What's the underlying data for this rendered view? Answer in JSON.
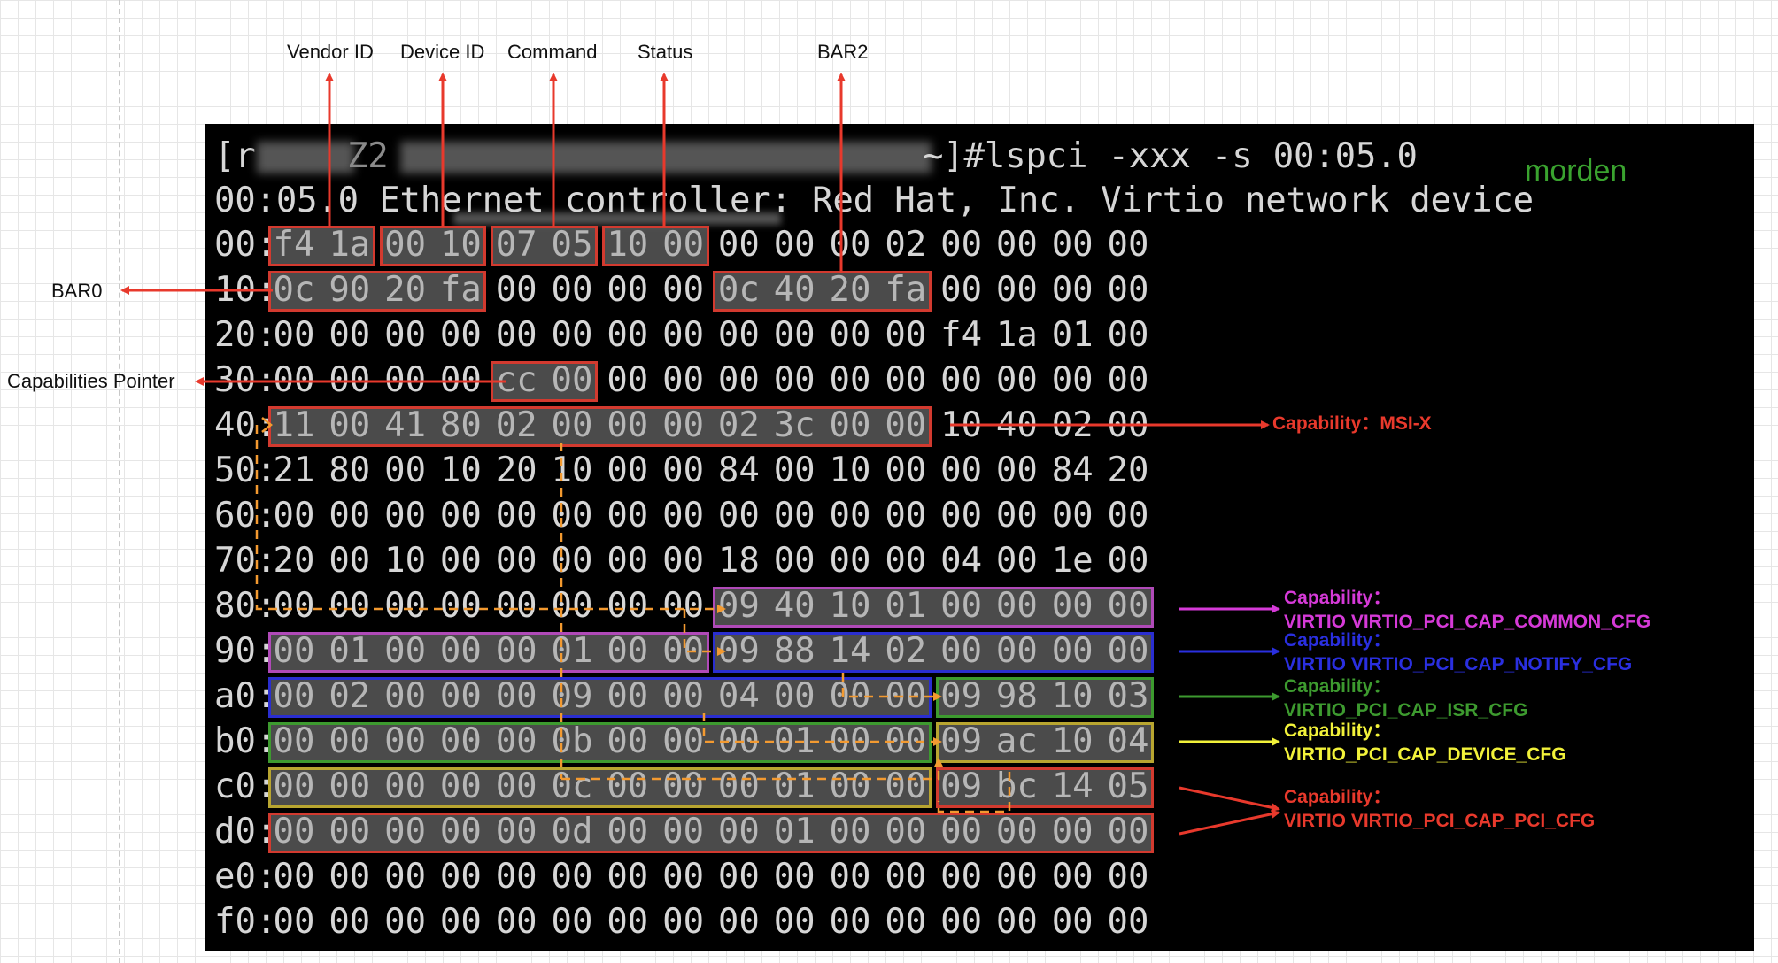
{
  "header_labels": [
    "Vendor ID",
    "Device ID",
    "Command",
    "Status",
    "BAR2"
  ],
  "side_labels": {
    "bar0": "BAR0",
    "capabilities_pointer": "Capabilities Pointer"
  },
  "tag": "morden",
  "terminal": {
    "prompt_prefix": "[r",
    "prompt_host_fragment": "Z2",
    "prompt_command": "~]#lspci -xxx -s 00:05.0",
    "device_line": "00:05.0 Ethernet controller: Red Hat, Inc. Virtio network device"
  },
  "hexdump": [
    {
      "label": "00:",
      "bytes": [
        "f4",
        "1a",
        "00",
        "10",
        "07",
        "05",
        "10",
        "00",
        "00",
        "00",
        "00",
        "02",
        "00",
        "00",
        "00",
        "00"
      ]
    },
    {
      "label": "10:",
      "bytes": [
        "0c",
        "90",
        "20",
        "fa",
        "00",
        "00",
        "00",
        "00",
        "0c",
        "40",
        "20",
        "fa",
        "00",
        "00",
        "00",
        "00"
      ]
    },
    {
      "label": "20:",
      "bytes": [
        "00",
        "00",
        "00",
        "00",
        "00",
        "00",
        "00",
        "00",
        "00",
        "00",
        "00",
        "00",
        "f4",
        "1a",
        "01",
        "00"
      ]
    },
    {
      "label": "30:",
      "bytes": [
        "00",
        "00",
        "00",
        "00",
        "cc",
        "00",
        "00",
        "00",
        "00",
        "00",
        "00",
        "00",
        "00",
        "00",
        "00",
        "00"
      ]
    },
    {
      "label": "40:",
      "bytes": [
        "11",
        "00",
        "41",
        "80",
        "02",
        "00",
        "00",
        "00",
        "02",
        "3c",
        "00",
        "00",
        "10",
        "40",
        "02",
        "00"
      ]
    },
    {
      "label": "50:",
      "bytes": [
        "21",
        "80",
        "00",
        "10",
        "20",
        "10",
        "00",
        "00",
        "84",
        "00",
        "10",
        "00",
        "00",
        "00",
        "84",
        "20"
      ]
    },
    {
      "label": "60:",
      "bytes": [
        "00",
        "00",
        "00",
        "00",
        "00",
        "00",
        "00",
        "00",
        "00",
        "00",
        "00",
        "00",
        "00",
        "00",
        "00",
        "00"
      ]
    },
    {
      "label": "70:",
      "bytes": [
        "20",
        "00",
        "10",
        "00",
        "00",
        "00",
        "00",
        "00",
        "18",
        "00",
        "00",
        "00",
        "04",
        "00",
        "1e",
        "00"
      ]
    },
    {
      "label": "80:",
      "bytes": [
        "00",
        "00",
        "00",
        "00",
        "00",
        "00",
        "00",
        "00",
        "09",
        "40",
        "10",
        "01",
        "00",
        "00",
        "00",
        "00"
      ]
    },
    {
      "label": "90:",
      "bytes": [
        "00",
        "01",
        "00",
        "00",
        "00",
        "01",
        "00",
        "00",
        "09",
        "88",
        "14",
        "02",
        "00",
        "00",
        "00",
        "00"
      ]
    },
    {
      "label": "a0:",
      "bytes": [
        "00",
        "02",
        "00",
        "00",
        "00",
        "09",
        "00",
        "00",
        "04",
        "00",
        "00",
        "00",
        "09",
        "98",
        "10",
        "03"
      ]
    },
    {
      "label": "b0:",
      "bytes": [
        "00",
        "00",
        "00",
        "00",
        "00",
        "0b",
        "00",
        "00",
        "00",
        "01",
        "00",
        "00",
        "09",
        "ac",
        "10",
        "04"
      ]
    },
    {
      "label": "c0:",
      "bytes": [
        "00",
        "00",
        "00",
        "00",
        "00",
        "0c",
        "00",
        "00",
        "00",
        "01",
        "00",
        "00",
        "09",
        "bc",
        "14",
        "05"
      ]
    },
    {
      "label": "d0:",
      "bytes": [
        "00",
        "00",
        "00",
        "00",
        "00",
        "0d",
        "00",
        "00",
        "00",
        "01",
        "00",
        "00",
        "00",
        "00",
        "00",
        "00"
      ]
    },
    {
      "label": "e0:",
      "bytes": [
        "00",
        "00",
        "00",
        "00",
        "00",
        "00",
        "00",
        "00",
        "00",
        "00",
        "00",
        "00",
        "00",
        "00",
        "00",
        "00"
      ]
    },
    {
      "label": "f0:",
      "bytes": [
        "00",
        "00",
        "00",
        "00",
        "00",
        "00",
        "00",
        "00",
        "00",
        "00",
        "00",
        "00",
        "00",
        "00",
        "00",
        "00"
      ]
    }
  ],
  "capabilities": [
    {
      "key": "msix",
      "title": "Capability：MSI-X",
      "color": "#e8392c"
    },
    {
      "key": "common",
      "title": "Capability：",
      "name": "VIRTIO VIRTIO_PCI_CAP_COMMON_CFG",
      "color": "#d63ad8"
    },
    {
      "key": "notify",
      "title": "Capability：",
      "name": "VIRTIO VIRTIO_PCI_CAP_NOTIFY_CFG",
      "color": "#2a2fe0"
    },
    {
      "key": "isr",
      "title": "Capability：",
      "name": "VIRTIO_PCI_CAP_ISR_CFG",
      "color": "#3d9a2f"
    },
    {
      "key": "device",
      "title": "Capability：",
      "name": "VIRTIO_PCI_CAP_DEVICE_CFG",
      "color": "#f2f23a"
    },
    {
      "key": "pci",
      "title": "Capability：",
      "name": "VIRTIO VIRTIO_PCI_CAP_PCI_CFG",
      "color": "#e8392c"
    }
  ],
  "colors": {
    "annotation_red": "#e8392c",
    "cap_orange": "#f39a30",
    "terminal_bg": "#000000",
    "terminal_text": "#d6d6d6"
  }
}
